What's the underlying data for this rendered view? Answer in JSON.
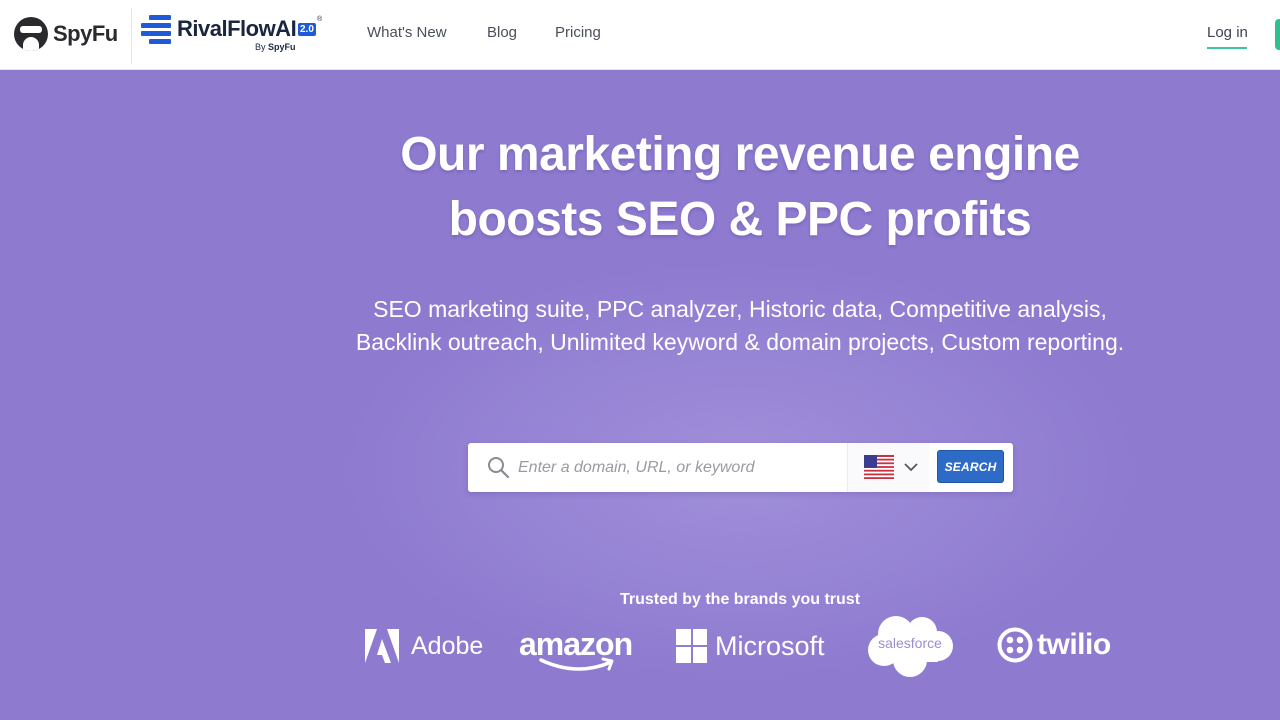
{
  "header": {
    "spyfu_logo_text": "SpyFu",
    "rivalflow_name": "RivalFlowAI",
    "rivalflow_version": "2.0",
    "rivalflow_by": "By",
    "rivalflow_by_brand": "SpyFu",
    "nav": [
      {
        "label": "What's New"
      },
      {
        "label": "Blog"
      },
      {
        "label": "Pricing"
      }
    ],
    "login_label": "Log in"
  },
  "hero": {
    "title_line1": "Our marketing revenue engine",
    "title_line2": "boosts SEO & PPC profits",
    "subtitle": "SEO marketing suite, PPC analyzer, Historic data, Competitive analysis, Backlink outreach, Unlimited keyword & domain projects, Custom reporting."
  },
  "search": {
    "placeholder": "Enter a domain, URL, or keyword",
    "value": "",
    "country_flag": "us-flag-icon",
    "button_label": "SEARCH"
  },
  "trusted": {
    "heading": "Trusted by the brands you trust",
    "brands": [
      "Adobe",
      "amazon",
      "Microsoft",
      "salesforce",
      "twilio"
    ]
  },
  "colors": {
    "background": "#8e7bd0",
    "accent_green": "#3cc5a0",
    "search_button": "#2d6bc7",
    "rivalflow_blue": "#1f5bd8"
  },
  "icons": [
    "spyfu-logo-icon",
    "rivalflow-logo-icon",
    "search-icon",
    "us-flag-icon",
    "chevron-down-icon",
    "adobe-logo-icon",
    "amazon-smile-icon",
    "microsoft-logo-icon",
    "salesforce-cloud-icon",
    "twilio-logo-icon"
  ]
}
